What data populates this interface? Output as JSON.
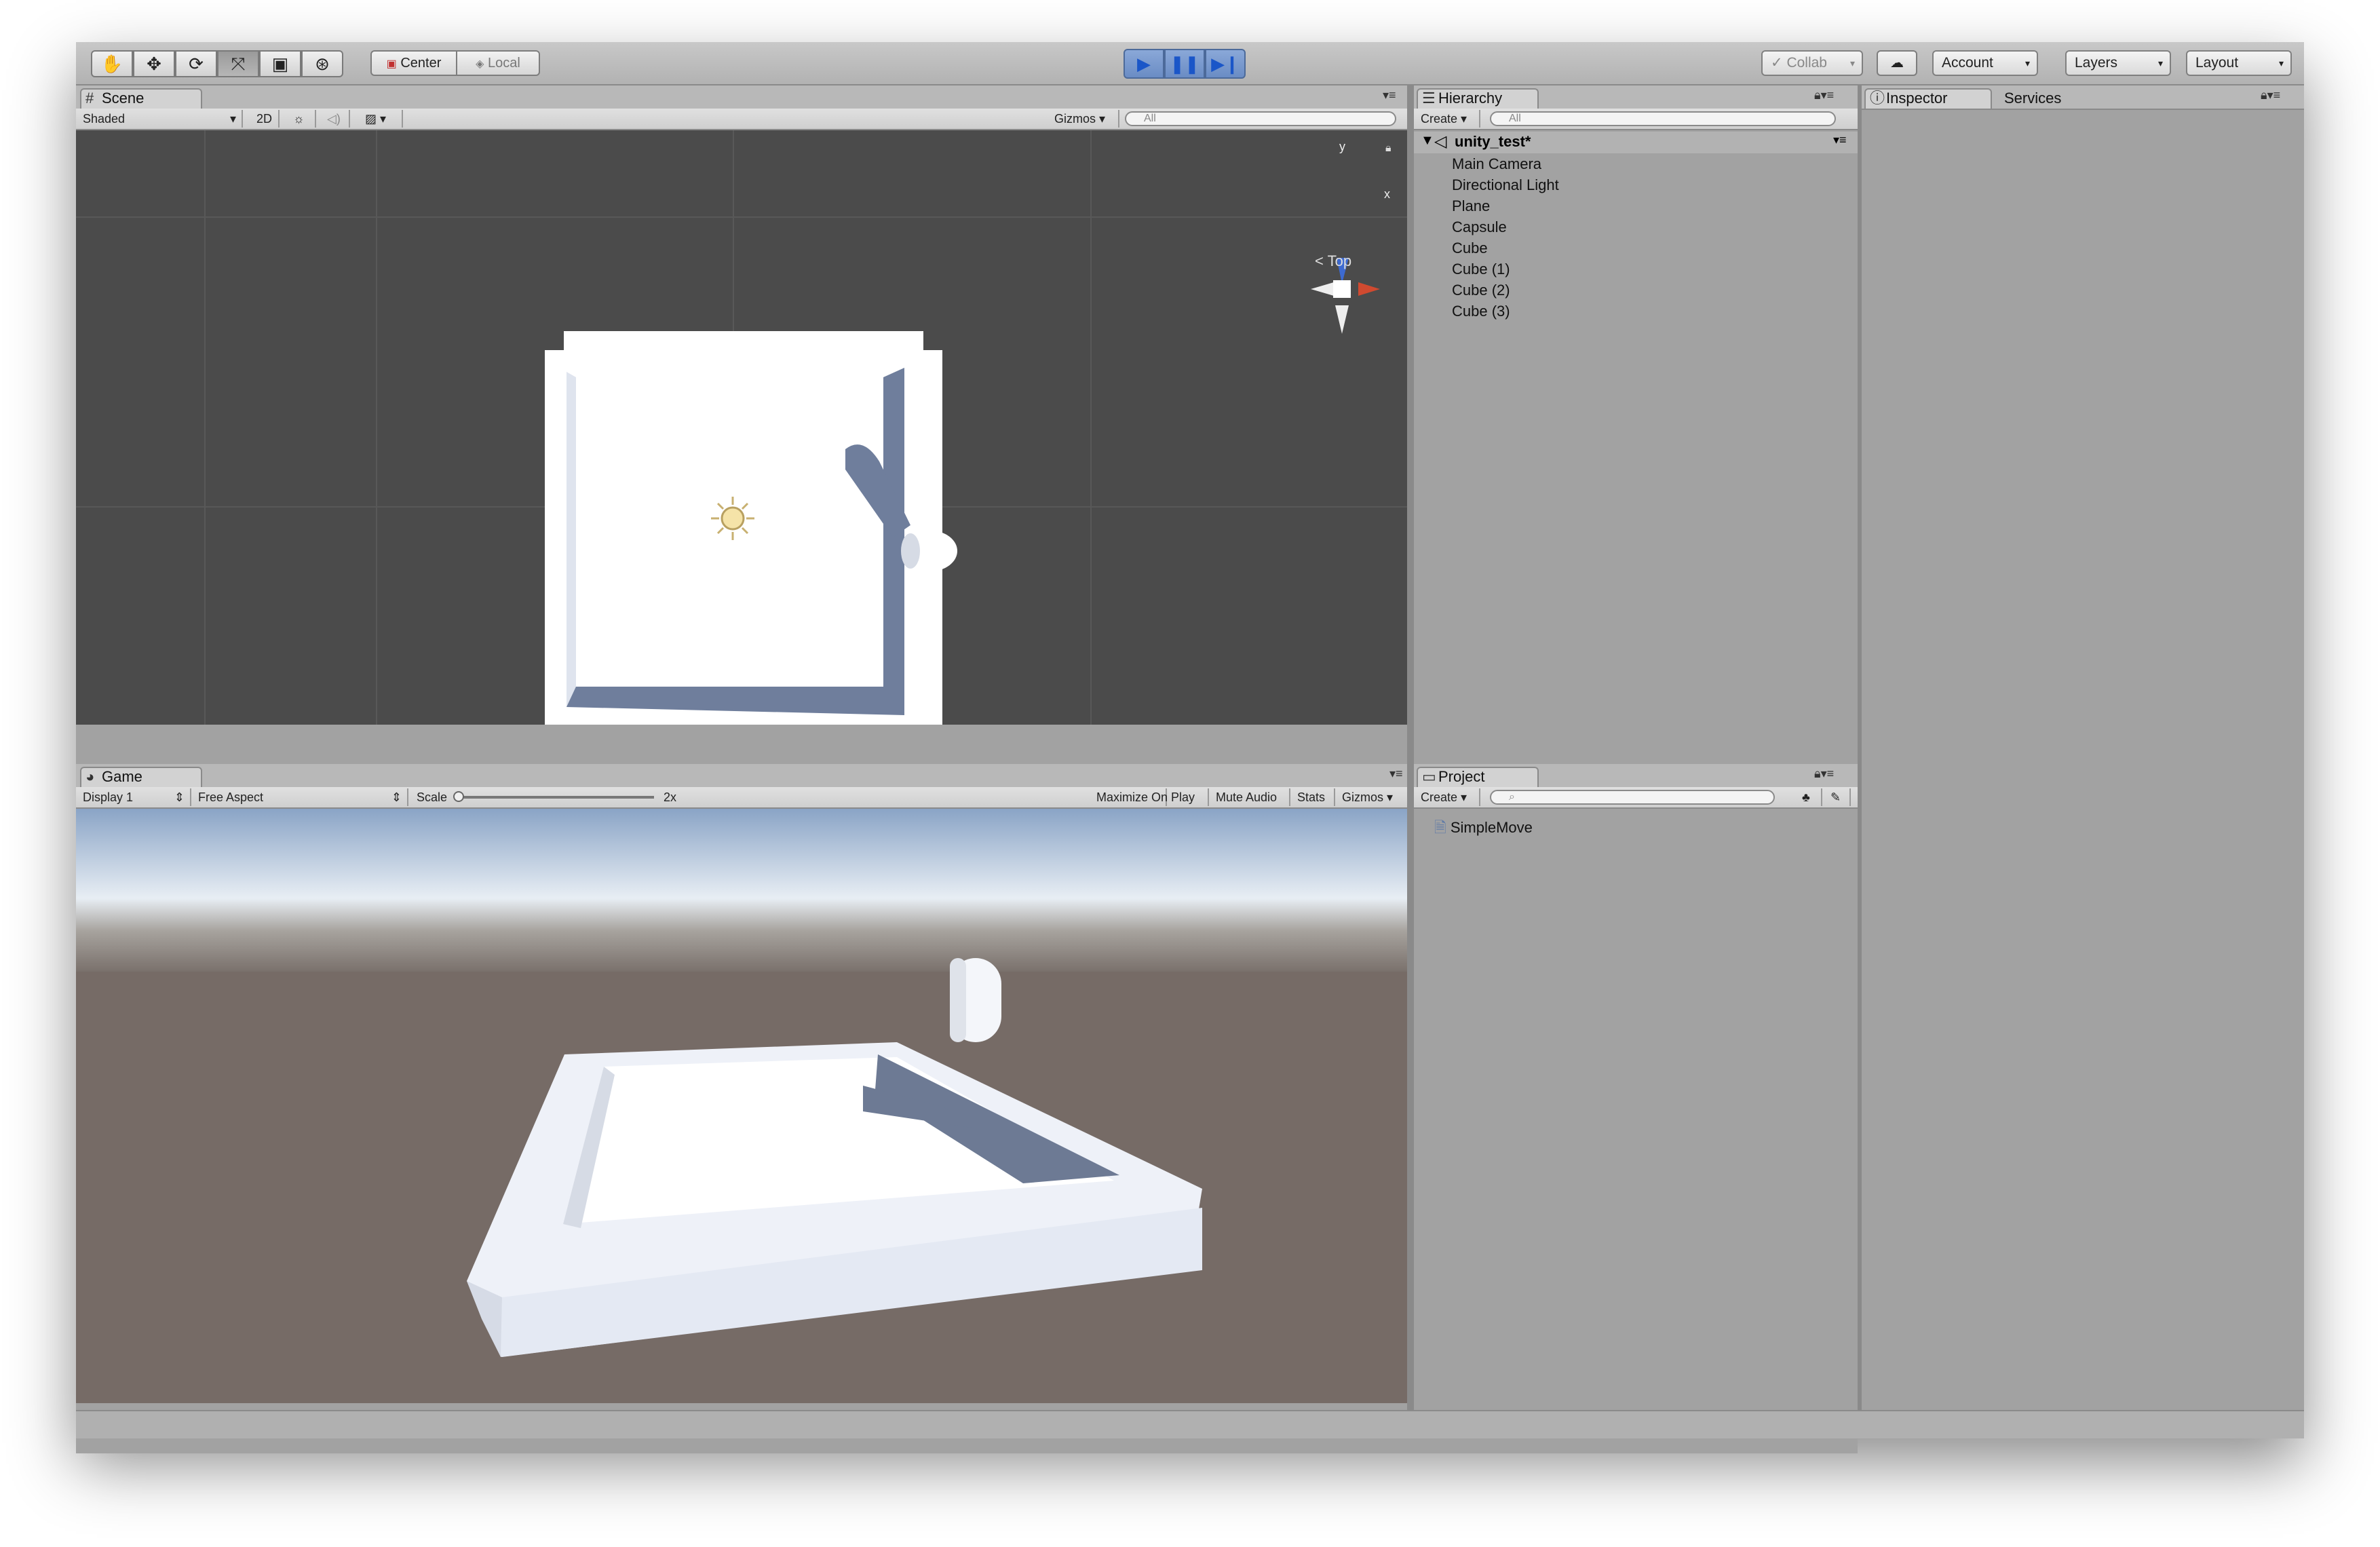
{
  "toolbar": {
    "pivot_center": "Center",
    "pivot_local": "Local",
    "collab": "Collab",
    "account": "Account",
    "layers": "Layers",
    "layout": "Layout"
  },
  "scene": {
    "tab": "Scene",
    "shading": "Shaded",
    "mode_2d": "2D",
    "gizmos": "Gizmos",
    "search_placeholder": "All",
    "axis_y": "y",
    "axis_x": "x",
    "view_label": "Top"
  },
  "game": {
    "tab": "Game",
    "display": "Display 1",
    "aspect": "Free Aspect",
    "scale_label": "Scale",
    "scale_value": "2x",
    "maximize": "Maximize On Play",
    "mute": "Mute Audio",
    "stats": "Stats",
    "gizmos": "Gizmos"
  },
  "hierarchy": {
    "tab": "Hierarchy",
    "create": "Create",
    "search_placeholder": "All",
    "scene_name": "unity_test*",
    "items": [
      "Main Camera",
      "Directional Light",
      "Plane",
      "Capsule",
      "Cube",
      "Cube (1)",
      "Cube (2)",
      "Cube (3)"
    ]
  },
  "project": {
    "tab": "Project",
    "create": "Create",
    "items": [
      "SimpleMove"
    ]
  },
  "inspector": {
    "tab": "Inspector",
    "services_tab": "Services"
  }
}
